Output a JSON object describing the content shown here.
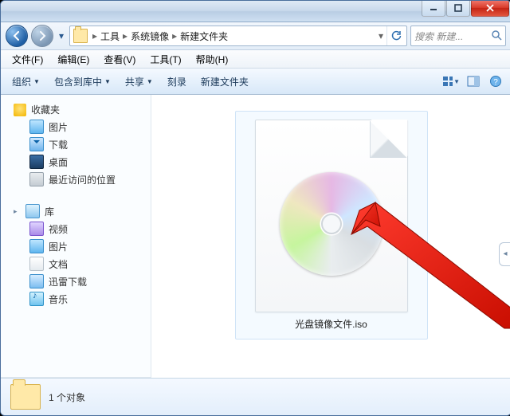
{
  "titlebar": {},
  "breadcrumb": {
    "segments": [
      "工具",
      "系统镜像",
      "新建文件夹"
    ]
  },
  "search": {
    "placeholder": "搜索 新建..."
  },
  "menus": {
    "file": "文件(F)",
    "edit": "编辑(E)",
    "view": "查看(V)",
    "tools": "工具(T)",
    "help": "帮助(H)"
  },
  "toolbar": {
    "organize": "组织",
    "include": "包含到库中",
    "share": "共享",
    "burn": "刻录",
    "newfolder": "新建文件夹"
  },
  "sidebar": {
    "favorites": {
      "label": "收藏夹",
      "items": {
        "pictures": "图片",
        "downloads": "下载",
        "desktop": "桌面",
        "recent": "最近访问的位置"
      }
    },
    "libraries": {
      "label": "库",
      "items": {
        "videos": "视频",
        "pictures": "图片",
        "documents": "文档",
        "thunder": "迅雷下载",
        "music": "音乐"
      }
    }
  },
  "content": {
    "files": [
      {
        "name": "光盘镜像文件.iso"
      }
    ]
  },
  "status": {
    "text": "1 个对象"
  }
}
